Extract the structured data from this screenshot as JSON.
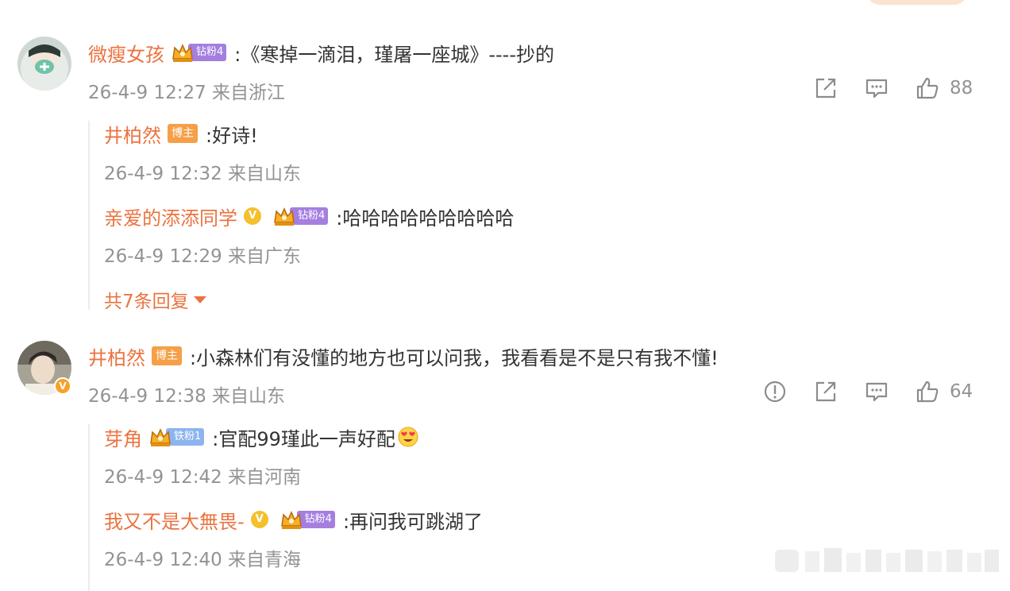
{
  "colors": {
    "name": "#eb7340",
    "meta": "#939393",
    "text": "#333333",
    "boss_badge": "#f5a048",
    "fan_purple": "#a47fe0",
    "fan_blue": "#8db4ef"
  },
  "comments": [
    {
      "author": "微瘦女孩",
      "fan_badge": "钻粉4",
      "text": ":《寒掉一滴泪，瑾屠一座城》----抄的",
      "time": "26-4-9 12:27 来自浙江",
      "like_count": "88",
      "icons": [
        "share-icon",
        "comment-icon",
        "like-icon"
      ],
      "replies": [
        {
          "author": "井柏然",
          "badge": "博主",
          "text": ":好诗!",
          "time": "26-4-9 12:32 来自山东"
        },
        {
          "author": "亲爱的添添同学",
          "verified": "V",
          "fan_badge": "钻粉4",
          "text": ":哈哈哈哈哈哈哈哈哈",
          "time": "26-4-9 12:29 来自广东"
        }
      ],
      "more_replies": "共7条回复"
    },
    {
      "author": "井柏然",
      "badge": "博主",
      "avatar_badge": "V",
      "text": ":小森林们有没懂的地方也可以问我，我看看是不是只有我不懂!",
      "time": "26-4-9 12:38 来自山东",
      "like_count": "64",
      "icons": [
        "report-icon",
        "share-icon",
        "comment-icon",
        "like-icon"
      ],
      "replies": [
        {
          "author": "芽角",
          "fan_badge": "铁粉1",
          "text": ":官配99瑾此一声好配",
          "emoji": "heart-eyes-emoji",
          "time": "26-4-9 12:42 来自河南"
        },
        {
          "author": "我又不是大無畏-",
          "verified": "V",
          "fan_badge": "钻粉4",
          "text": ":再问我可跳湖了",
          "time": "26-4-9 12:40 来自青海"
        }
      ]
    }
  ]
}
